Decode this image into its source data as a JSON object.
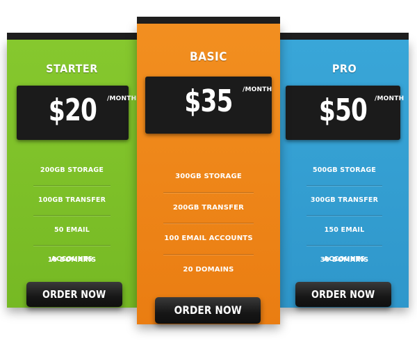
{
  "plans": [
    {
      "name": "STARTER",
      "price": "$20",
      "period": "/MONTH",
      "features": [
        "200GB STORAGE",
        "100GB TRANSFER",
        "50 EMAIL ACCOUNTS",
        "10 DOMAINS"
      ],
      "button": "ORDER NOW",
      "color": "#7fc22b"
    },
    {
      "name": "BASIC",
      "price": "$35",
      "period": "/MONTH",
      "features": [
        "300GB STORAGE",
        "200GB TRANSFER",
        "100 EMAIL ACCOUNTS",
        "20 DOMAINS"
      ],
      "button": "ORDER NOW",
      "color": "#f08a1c"
    },
    {
      "name": "PRO",
      "price": "$50",
      "period": "/MONTH",
      "features": [
        "500GB STORAGE",
        "300GB TRANSFER",
        "150 EMAIL ACCOUNTS",
        "30 DOMAINS"
      ],
      "button": "ORDER NOW",
      "color": "#35a1d4"
    }
  ]
}
